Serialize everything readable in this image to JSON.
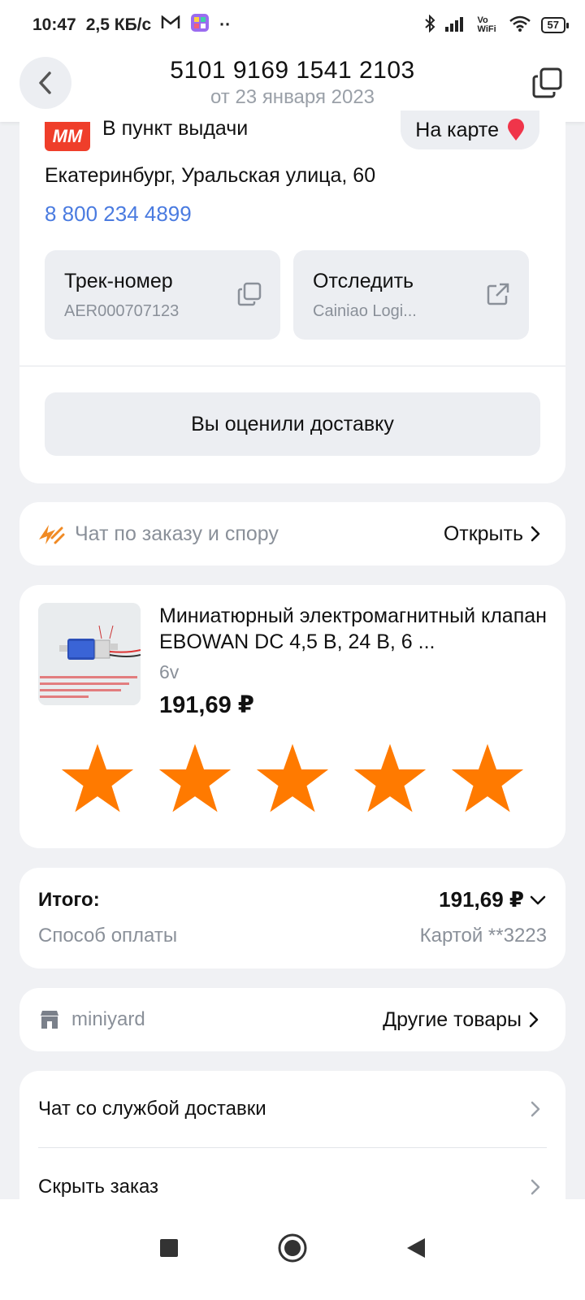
{
  "status_bar": {
    "time": "10:47",
    "speed": "2,5 КБ/с",
    "wifi_label": "Vo WiFi",
    "battery": "57"
  },
  "header": {
    "order_number": "5101 9169 1541 2103",
    "order_date": "от 23 января 2023"
  },
  "pickup": {
    "logo_text": "ММ",
    "label": "В пункт выдачи",
    "map_button": "На карте",
    "address": "Екатеринбург, Уральская улица, 60",
    "phone": "8 800 234 4899",
    "track_title": "Трек-номер",
    "track_value": "AER000707123",
    "follow_title": "Отследить",
    "follow_value": "Cainiao Logi...",
    "rated_button": "Вы оценили доставку"
  },
  "chat": {
    "label": "Чат по заказу и спору",
    "action": "Открыть"
  },
  "product": {
    "title": "Миниатюрный электромагнитный клапан EBOWAN DC 4,5 В, 24 В, 6 ...",
    "variant": "6v",
    "price": "191,69 ₽",
    "rating": 5,
    "star_color": "#ff7a00"
  },
  "totals": {
    "total_label": "Итого:",
    "total_value": "191,69 ₽",
    "payment_label": "Способ оплаты",
    "payment_value": "Картой **3223"
  },
  "store": {
    "name": "miniyard",
    "action": "Другие товары"
  },
  "menu": {
    "items": [
      {
        "label": "Чат со службой доставки"
      },
      {
        "label": "Скрыть заказ"
      }
    ]
  },
  "colors": {
    "accent_link": "#4a7be0",
    "brand_red": "#ef3e2a",
    "star_orange": "#ff7a00"
  }
}
